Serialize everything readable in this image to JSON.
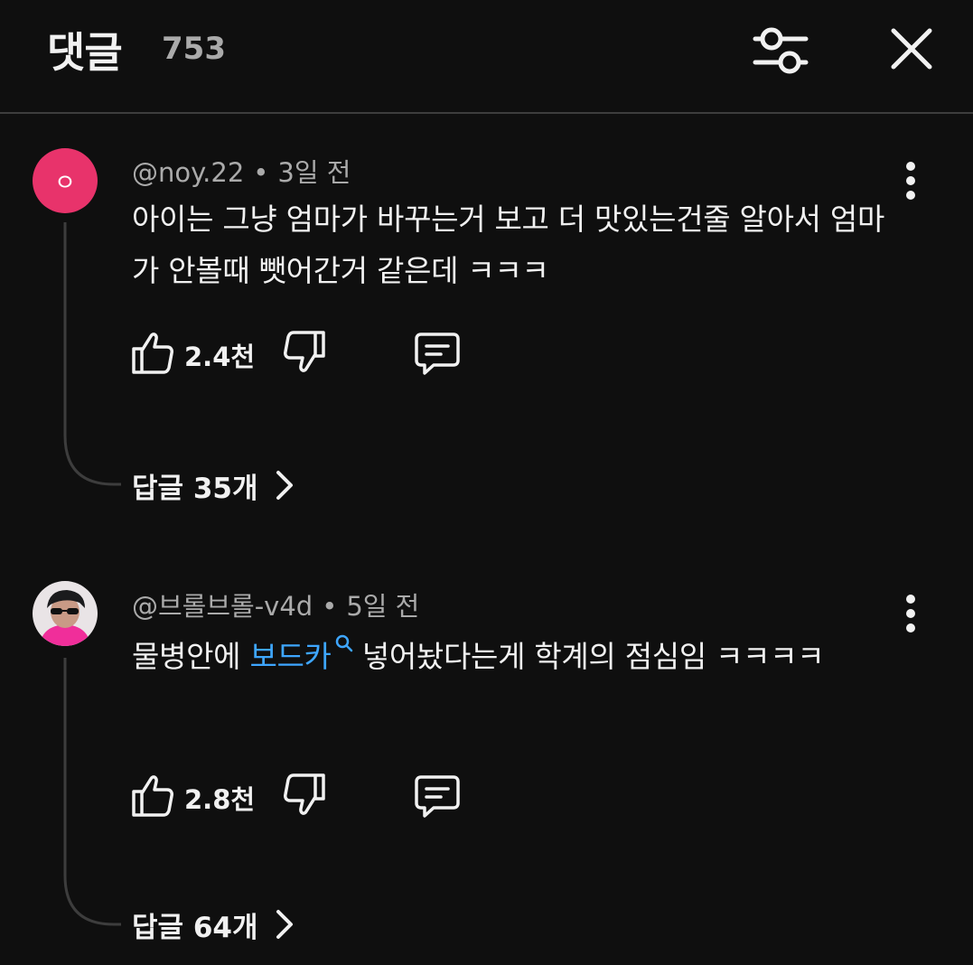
{
  "header": {
    "title": "댓글",
    "count": "753"
  },
  "icons": {
    "filter": "filter-sliders-icon",
    "close": "close-icon",
    "more": "more-vert-icon",
    "like": "thumb-up-icon",
    "dislike": "thumb-down-icon",
    "reply": "reply-comment-icon",
    "chevron": "chevron-right-icon",
    "search": "search-icon"
  },
  "colors": {
    "background": "#0f0f0f",
    "text": "#f1f1f1",
    "secondary": "#aaaaaa",
    "link": "#3ea6ff",
    "avatar_pink": "#e8336b"
  },
  "comments": [
    {
      "author": "@noy.22",
      "time": "3일 전",
      "avatar_letter": "ㅇ",
      "text": "아이는 그냥 엄마가 바꾸는거 보고 더 맛있는건줄 알아서 엄마가 안볼때 뺏어간거 같은데 ㅋㅋㅋ",
      "likes": "2.4천",
      "replies": "답글 35개"
    },
    {
      "author": "@브롤브롤-v4d",
      "time": "5일 전",
      "text_before": "물병안에 ",
      "text_link": "보드카",
      "text_after": " 넣어놨다는게 학계의 점심임 ㅋㅋㅋㅋ",
      "likes": "2.8천",
      "replies": "답글 64개"
    }
  ]
}
